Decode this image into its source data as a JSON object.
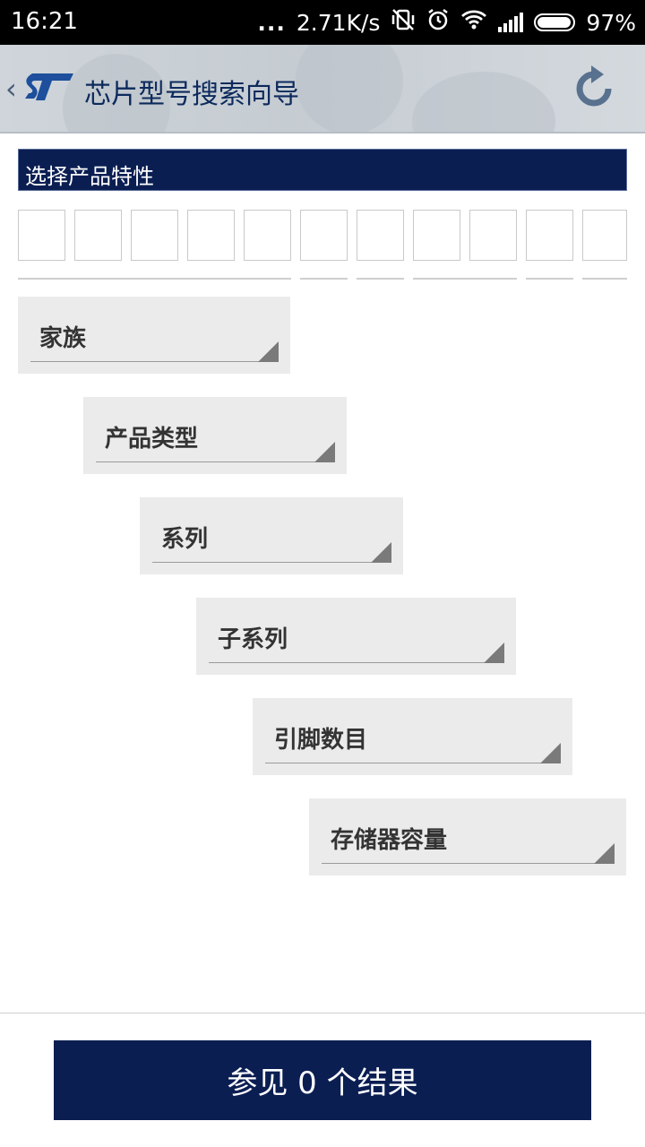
{
  "status_bar": {
    "time": "16:21",
    "dots": "...",
    "speed": "2.71K/s",
    "battery": "97%"
  },
  "app_bar": {
    "back": "‹",
    "title": "芯片型号搜索向导"
  },
  "section": {
    "title": "选择产品特性"
  },
  "filters": {
    "family": "家族",
    "product_type": "产品类型",
    "series": "系列",
    "subseries": "子系列",
    "pin_count": "引脚数目",
    "memory_size": "存储器容量"
  },
  "footer": {
    "results_label": "参见 0 个结果"
  },
  "colors": {
    "primary": "#0a1e52",
    "dropdown_bg": "#ebebeb"
  }
}
